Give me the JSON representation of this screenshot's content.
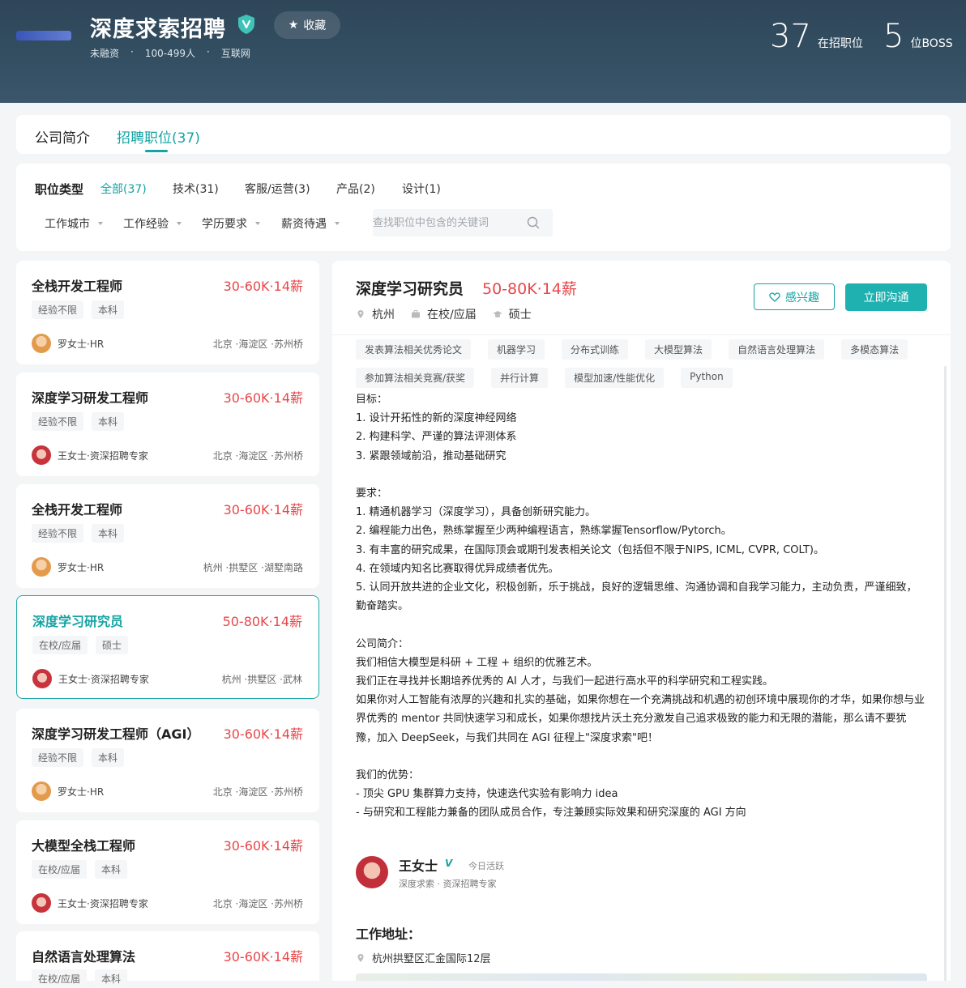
{
  "company": {
    "name": "深度求索招聘",
    "favorite_label": "收藏",
    "meta": [
      "未融资",
      "·",
      "100-499人",
      "·",
      "互联网"
    ],
    "stats": [
      {
        "num": "37",
        "label": "在招职位"
      },
      {
        "num": "5",
        "label": "位BOSS"
      }
    ]
  },
  "tabs": [
    {
      "label": "公司简介"
    },
    {
      "label": "招聘职位(37)"
    }
  ],
  "filters": {
    "type_label": "职位类型",
    "types": [
      "全部(37)",
      "技术(31)",
      "客服/运营(3)",
      "产品(2)",
      "设计(1)"
    ],
    "dropdowns": [
      "工作城市",
      "工作经验",
      "学历要求",
      "薪资待遇"
    ],
    "search_placeholder": "查找职位中包含的关键词"
  },
  "jobs": [
    {
      "title": "全栈开发工程师",
      "salary": "30-60K·14薪",
      "tags": [
        "经验不限",
        "本科"
      ],
      "hr": "罗女士·HR",
      "location": "北京 ·海淀区 ·苏州桥"
    },
    {
      "title": "深度学习研发工程师",
      "salary": "30-60K·14薪",
      "tags": [
        "经验不限",
        "本科"
      ],
      "hr": "王女士·资深招聘专家",
      "location": "北京 ·海淀区 ·苏州桥"
    },
    {
      "title": "全栈开发工程师",
      "salary": "30-60K·14薪",
      "tags": [
        "经验不限",
        "本科"
      ],
      "hr": "罗女士·HR",
      "location": "杭州 ·拱墅区 ·湖墅南路"
    },
    {
      "title": "深度学习研究员",
      "salary": "50-80K·14薪",
      "tags": [
        "在校/应届",
        "硕士"
      ],
      "hr": "王女士·资深招聘专家",
      "location": "杭州 ·拱墅区 ·武林"
    },
    {
      "title": "深度学习研发工程师（AGI）",
      "salary": "30-60K·14薪",
      "tags": [
        "经验不限",
        "本科"
      ],
      "hr": "罗女士·HR",
      "location": "北京 ·海淀区 ·苏州桥"
    },
    {
      "title": "大模型全栈工程师",
      "salary": "30-60K·14薪",
      "tags": [
        "在校/应届",
        "本科"
      ],
      "hr": "王女士·资深招聘专家",
      "location": "北京 ·海淀区 ·苏州桥"
    },
    {
      "title": "自然语言处理算法",
      "salary": "30-60K·14薪",
      "tags": [
        "在校/应届",
        "本科"
      ],
      "hr": "",
      "location": ""
    }
  ],
  "detail": {
    "title": "深度学习研究员",
    "salary": "50-80K·14薪",
    "city": "杭州",
    "experience": "在校/应届",
    "education": "硕士",
    "interest_label": "感兴趣",
    "chat_label": "立即沟通",
    "skills": [
      "发表算法相关优秀论文",
      "机器学习",
      "分布式训练",
      "大模型算法",
      "自然语言处理算法",
      "多模态算法",
      "参加算法相关竞赛/获奖",
      "并行计算",
      "模型加速/性能优化",
      "Python"
    ],
    "description": "目标：\n1. 设计开拓性的新的深度神经网络\n2. 构建科学、严谨的算法评测体系\n3. 紧跟领域前沿，推动基础研究\n\n要求：\n1. 精通机器学习（深度学习），具备创新研究能力。\n2. 编程能力出色，熟练掌握至少两种编程语言，熟练掌握Tensorflow/Pytorch。\n3. 有丰富的研究成果，在国际顶会或期刊发表相关论文（包括但不限于NIPS, ICML, CVPR, COLT)。\n4. 在领域内知名比赛取得优异成绩者优先。\n5. 认同开放共进的企业文化，积极创新，乐于挑战，良好的逻辑思维、沟通协调和自我学习能力，主动负责，严谨细致，勤奋踏实。\n\n公司简介：\n我们相信大模型是科研 + 工程 + 组织的优雅艺术。\n我们正在寻找并长期培养优秀的 AI 人才，与我们一起进行高水平的科学研究和工程实践。\n如果你对人工智能有浓厚的兴趣和扎实的基础，如果你想在一个充满挑战和机遇的初创环境中展现你的才华，如果你想与业界优秀的 mentor 共同快速学习和成长，如果你想找片沃土充分激发自己追求极致的能力和无限的潜能，那么请不要犹豫，加入 DeepSeek，与我们共同在 AGI 征程上\"深度求索\"吧！\n\n我们的优势：\n- 顶尖 GPU 集群算力支持，快速迭代实验有影响力 idea\n- 与研究和工程能力兼备的团队成员合作，专注兼顾实际效果和研究深度的 AGI 方向",
    "recruiter": {
      "name": "王女士",
      "badge": "V",
      "active": "今日活跃",
      "title": "深度求索 · 资深招聘专家"
    },
    "address_title": "工作地址：",
    "address": "杭州拱墅区汇金国际12层"
  }
}
